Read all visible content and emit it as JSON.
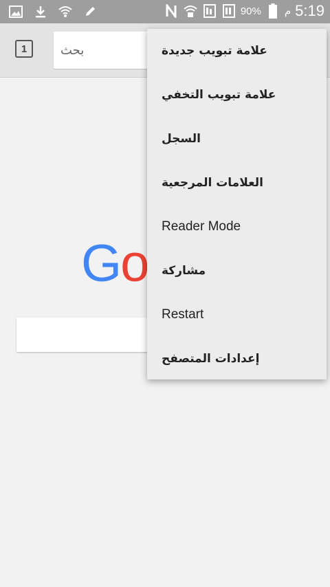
{
  "status_bar": {
    "left_icons": [
      "image-icon",
      "download-icon",
      "wifi-icon",
      "edit-icon"
    ],
    "right_icons": [
      "nfc-icon",
      "wifi-calling-icon",
      "sim1-icon",
      "sim2-icon",
      "battery-icon"
    ],
    "battery": "90%",
    "time": "5:19",
    "ampm": "م"
  },
  "toolbar": {
    "tab_count": "1",
    "search_placeholder": "بحث"
  },
  "page": {
    "logo_visible": "Go"
  },
  "menu": {
    "items": [
      {
        "label": "علامة تبويب جديدة",
        "lang": "ar"
      },
      {
        "label": "علامة تبويب التخفي",
        "lang": "ar"
      },
      {
        "label": "السجل",
        "lang": "ar"
      },
      {
        "label": "العلامات المرجعية",
        "lang": "ar"
      },
      {
        "label": "Reader Mode",
        "lang": "en"
      },
      {
        "label": "مشاركة",
        "lang": "ar"
      },
      {
        "label": "Restart",
        "lang": "en"
      },
      {
        "label": "إعدادات المتصفح",
        "lang": "ar"
      }
    ]
  },
  "colors": {
    "status_bar": "#9e9e9e",
    "toolbar": "#e3e3e3",
    "menu_bg": "#ececec",
    "google_blue": "#4285f4",
    "google_red": "#ea4335"
  }
}
